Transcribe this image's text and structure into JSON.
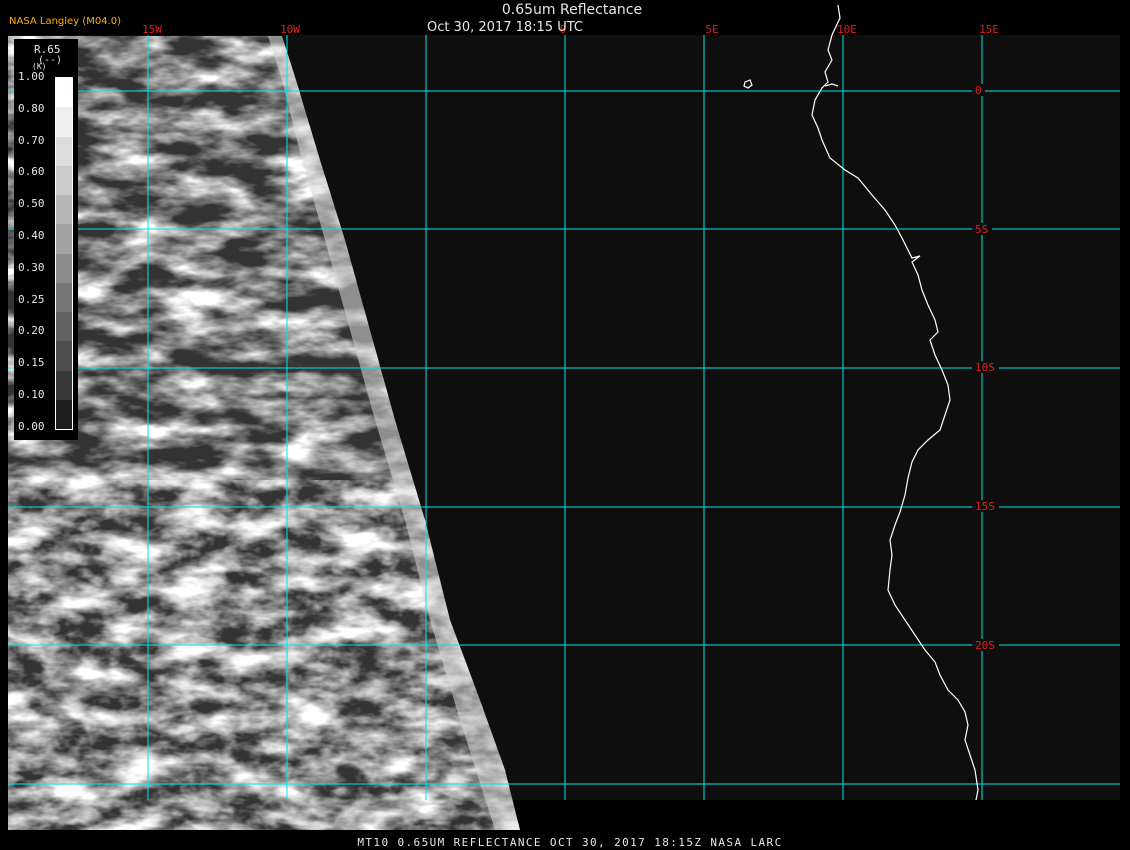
{
  "header": {
    "title": "0.65um Reflectance",
    "subtitle": "Oct 30, 2017 18:15 UTC",
    "credit": "NASA Langley (M04.0)"
  },
  "footer": {
    "text": "MT10  0.65UM REFLECTANCE   OCT 30, 2017 18:15Z   NASA LARC"
  },
  "legend": {
    "label": "R.65",
    "unit": "(--)",
    "unit_prefix": "(K)",
    "ticks": [
      "1.00",
      "0.80",
      "0.70",
      "0.60",
      "0.50",
      "0.40",
      "0.30",
      "0.25",
      "0.20",
      "0.15",
      "0.10",
      "0.00"
    ],
    "shades": [
      "#ffffff",
      "#eeeeee",
      "#dcdcdc",
      "#cacaca",
      "#b6b6b6",
      "#a2a2a2",
      "#8c8c8c",
      "#777777",
      "#626262",
      "#4e4e4e",
      "#393939",
      "#1e1e1e"
    ]
  },
  "map": {
    "longitude_labels": [
      "15W",
      "10W",
      "0",
      "5E",
      "10E",
      "15E"
    ],
    "latitude_labels": [
      "0",
      "5S",
      "10S",
      "15S",
      "20S"
    ],
    "grid_color": "#00e5e5",
    "label_color": "#e02020",
    "coast_color": "#ffffff",
    "background_color": "#0e0e0e"
  }
}
